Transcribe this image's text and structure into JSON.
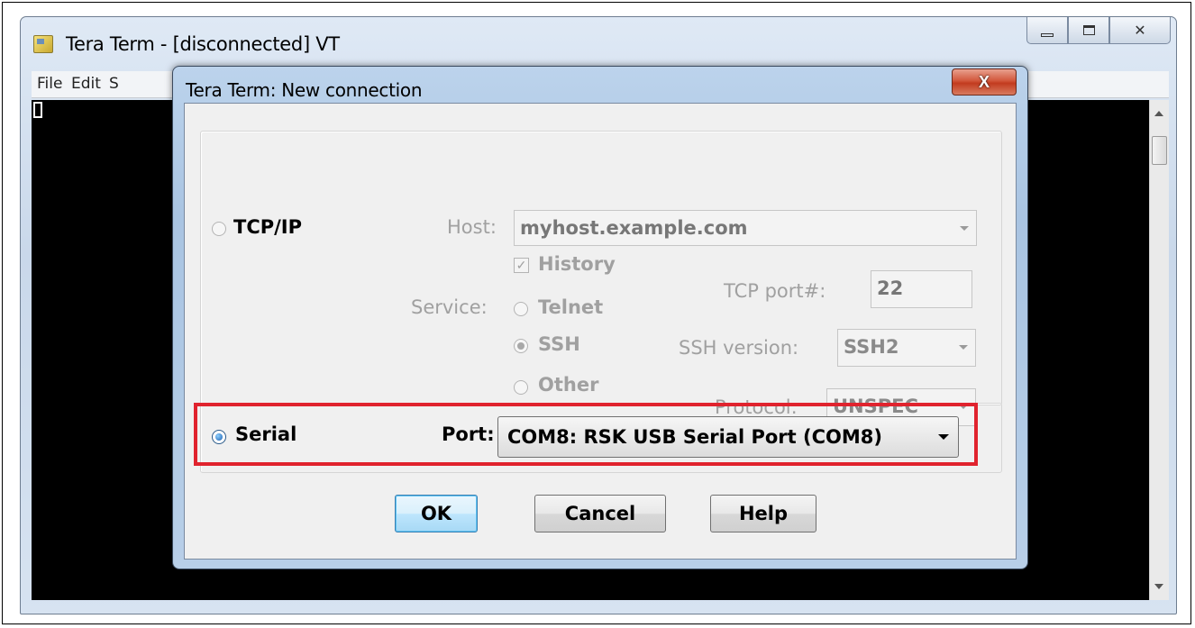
{
  "main_window": {
    "title": "Tera Term - [disconnected] VT",
    "menu": [
      "File",
      "Edit",
      "S"
    ]
  },
  "dialog": {
    "title": "Tera Term: New connection",
    "close_glyph": "X",
    "tcpip": {
      "radio_label": "TCP/IP",
      "host_label": "Host:",
      "host_value": "myhost.example.com",
      "history_label": "History",
      "history_checked": true,
      "service_label": "Service:",
      "services": [
        "Telnet",
        "SSH",
        "Other"
      ],
      "selected_service": "SSH",
      "tcp_port_label": "TCP port#:",
      "tcp_port_value": "22",
      "ssh_version_label": "SSH version:",
      "ssh_version_value": "SSH2",
      "protocol_label": "Protocol:",
      "protocol_value": "UNSPEC"
    },
    "serial": {
      "radio_label": "Serial",
      "port_label": "Port:",
      "port_value": "COM8: RSK USB Serial Port (COM8)"
    },
    "buttons": {
      "ok": "OK",
      "cancel": "Cancel",
      "help": "Help"
    }
  },
  "colors": {
    "highlight": "#e0232e",
    "terminal_bg": "#000000"
  }
}
